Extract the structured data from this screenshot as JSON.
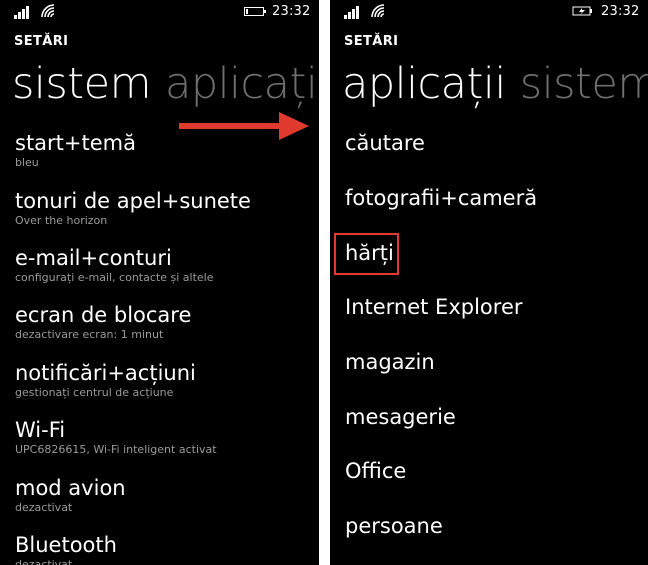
{
  "left": {
    "status": {
      "time": "23:32"
    },
    "settings_label": "SETĂRI",
    "pivot": {
      "active": "sistem",
      "next": "aplicații"
    },
    "items": [
      {
        "label": "start+temă",
        "sub": "bleu"
      },
      {
        "label": "tonuri de apel+sunete",
        "sub": "Over the horizon"
      },
      {
        "label": "e-mail+conturi",
        "sub": "configurați e-mail, contacte și altele"
      },
      {
        "label": "ecran de blocare",
        "sub": "dezactivare ecran: 1 minut"
      },
      {
        "label": "notificări+acțiuni",
        "sub": "gestionați centrul de acțiune"
      },
      {
        "label": "Wi-Fi",
        "sub": "UPC6826615, Wi-Fi inteligent activat"
      },
      {
        "label": "mod avion",
        "sub": "dezactivat"
      },
      {
        "label": "Bluetooth",
        "sub": "dezactivat"
      }
    ]
  },
  "right": {
    "status": {
      "time": "23:32"
    },
    "settings_label": "SETĂRI",
    "pivot": {
      "active": "aplicații",
      "next": "sistem"
    },
    "items": [
      "căutare",
      "fotografii+cameră",
      "hărți",
      "Internet Explorer",
      "magazin",
      "mesagerie",
      "Office",
      "persoane"
    ]
  },
  "colors": {
    "highlight": "#e03a2f",
    "arrow": "#e03a2f",
    "inactive_pivot": "#6f6f6f",
    "subtext": "#9a9a9a"
  }
}
